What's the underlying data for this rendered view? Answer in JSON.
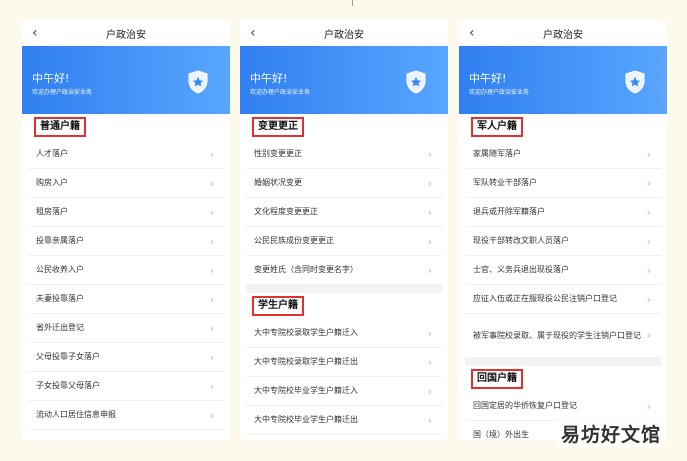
{
  "screens": [
    {
      "nav_title": "户政治安",
      "greeting": "中午好!",
      "subtitle": "欢迎办理户政治安业务",
      "sections": [
        {
          "title": "普通户籍",
          "items": [
            "人才落户",
            "购房入户",
            "租房落户",
            "投靠亲属落户",
            "公民收养入户",
            "夫妻投靠落户",
            "省外迁出登记",
            "父母投靠子女落户",
            "子女投靠父母落户",
            "流动人口居住信息申报"
          ]
        }
      ]
    },
    {
      "nav_title": "户政治安",
      "greeting": "中午好!",
      "subtitle": "欢迎办理户政治安业务",
      "sections": [
        {
          "title": "变更更正",
          "items": [
            "性别变更更正",
            "婚姻状况变更",
            "文化程度变更更正",
            "公民民族成份变更更正",
            "变更姓氏（含同时变更名字）"
          ]
        },
        {
          "title": "学生户籍",
          "items": [
            "大中专院校录取学生户籍迁入",
            "大中专院校录取学生户籍迁出",
            "大中专院校毕业学生户籍迁入",
            "大中专院校毕业学生户籍迁出"
          ]
        }
      ]
    },
    {
      "nav_title": "户政治安",
      "greeting": "中午好!",
      "subtitle": "欢迎办理户政治安业务",
      "sections": [
        {
          "title": "军人户籍",
          "items": [
            "家属随军落户",
            "军队转业干部落户",
            "退兵或开除军籍落户",
            "现役干部转改文职人员落户",
            "士官、义务兵退出现役落户",
            "应征入伍或正在服现役公民注销户口登记",
            "被军事院校录取、属于现役的学生注销户口登记"
          ]
        },
        {
          "title": "回国户籍",
          "items": [
            "回国定居的华侨恢复户口登记",
            "国（境）外出生"
          ]
        }
      ]
    }
  ],
  "watermark": "易坊好文馆",
  "colors": {
    "banner_start": "#2f7ff0",
    "banner_end": "#58a6ff",
    "highlight_box": "#e23030",
    "background": "#fdf9ec"
  },
  "icons": {
    "back": "chevron-left-icon",
    "badge": "police-shield-icon",
    "row_arrow": "chevron-right-icon"
  }
}
